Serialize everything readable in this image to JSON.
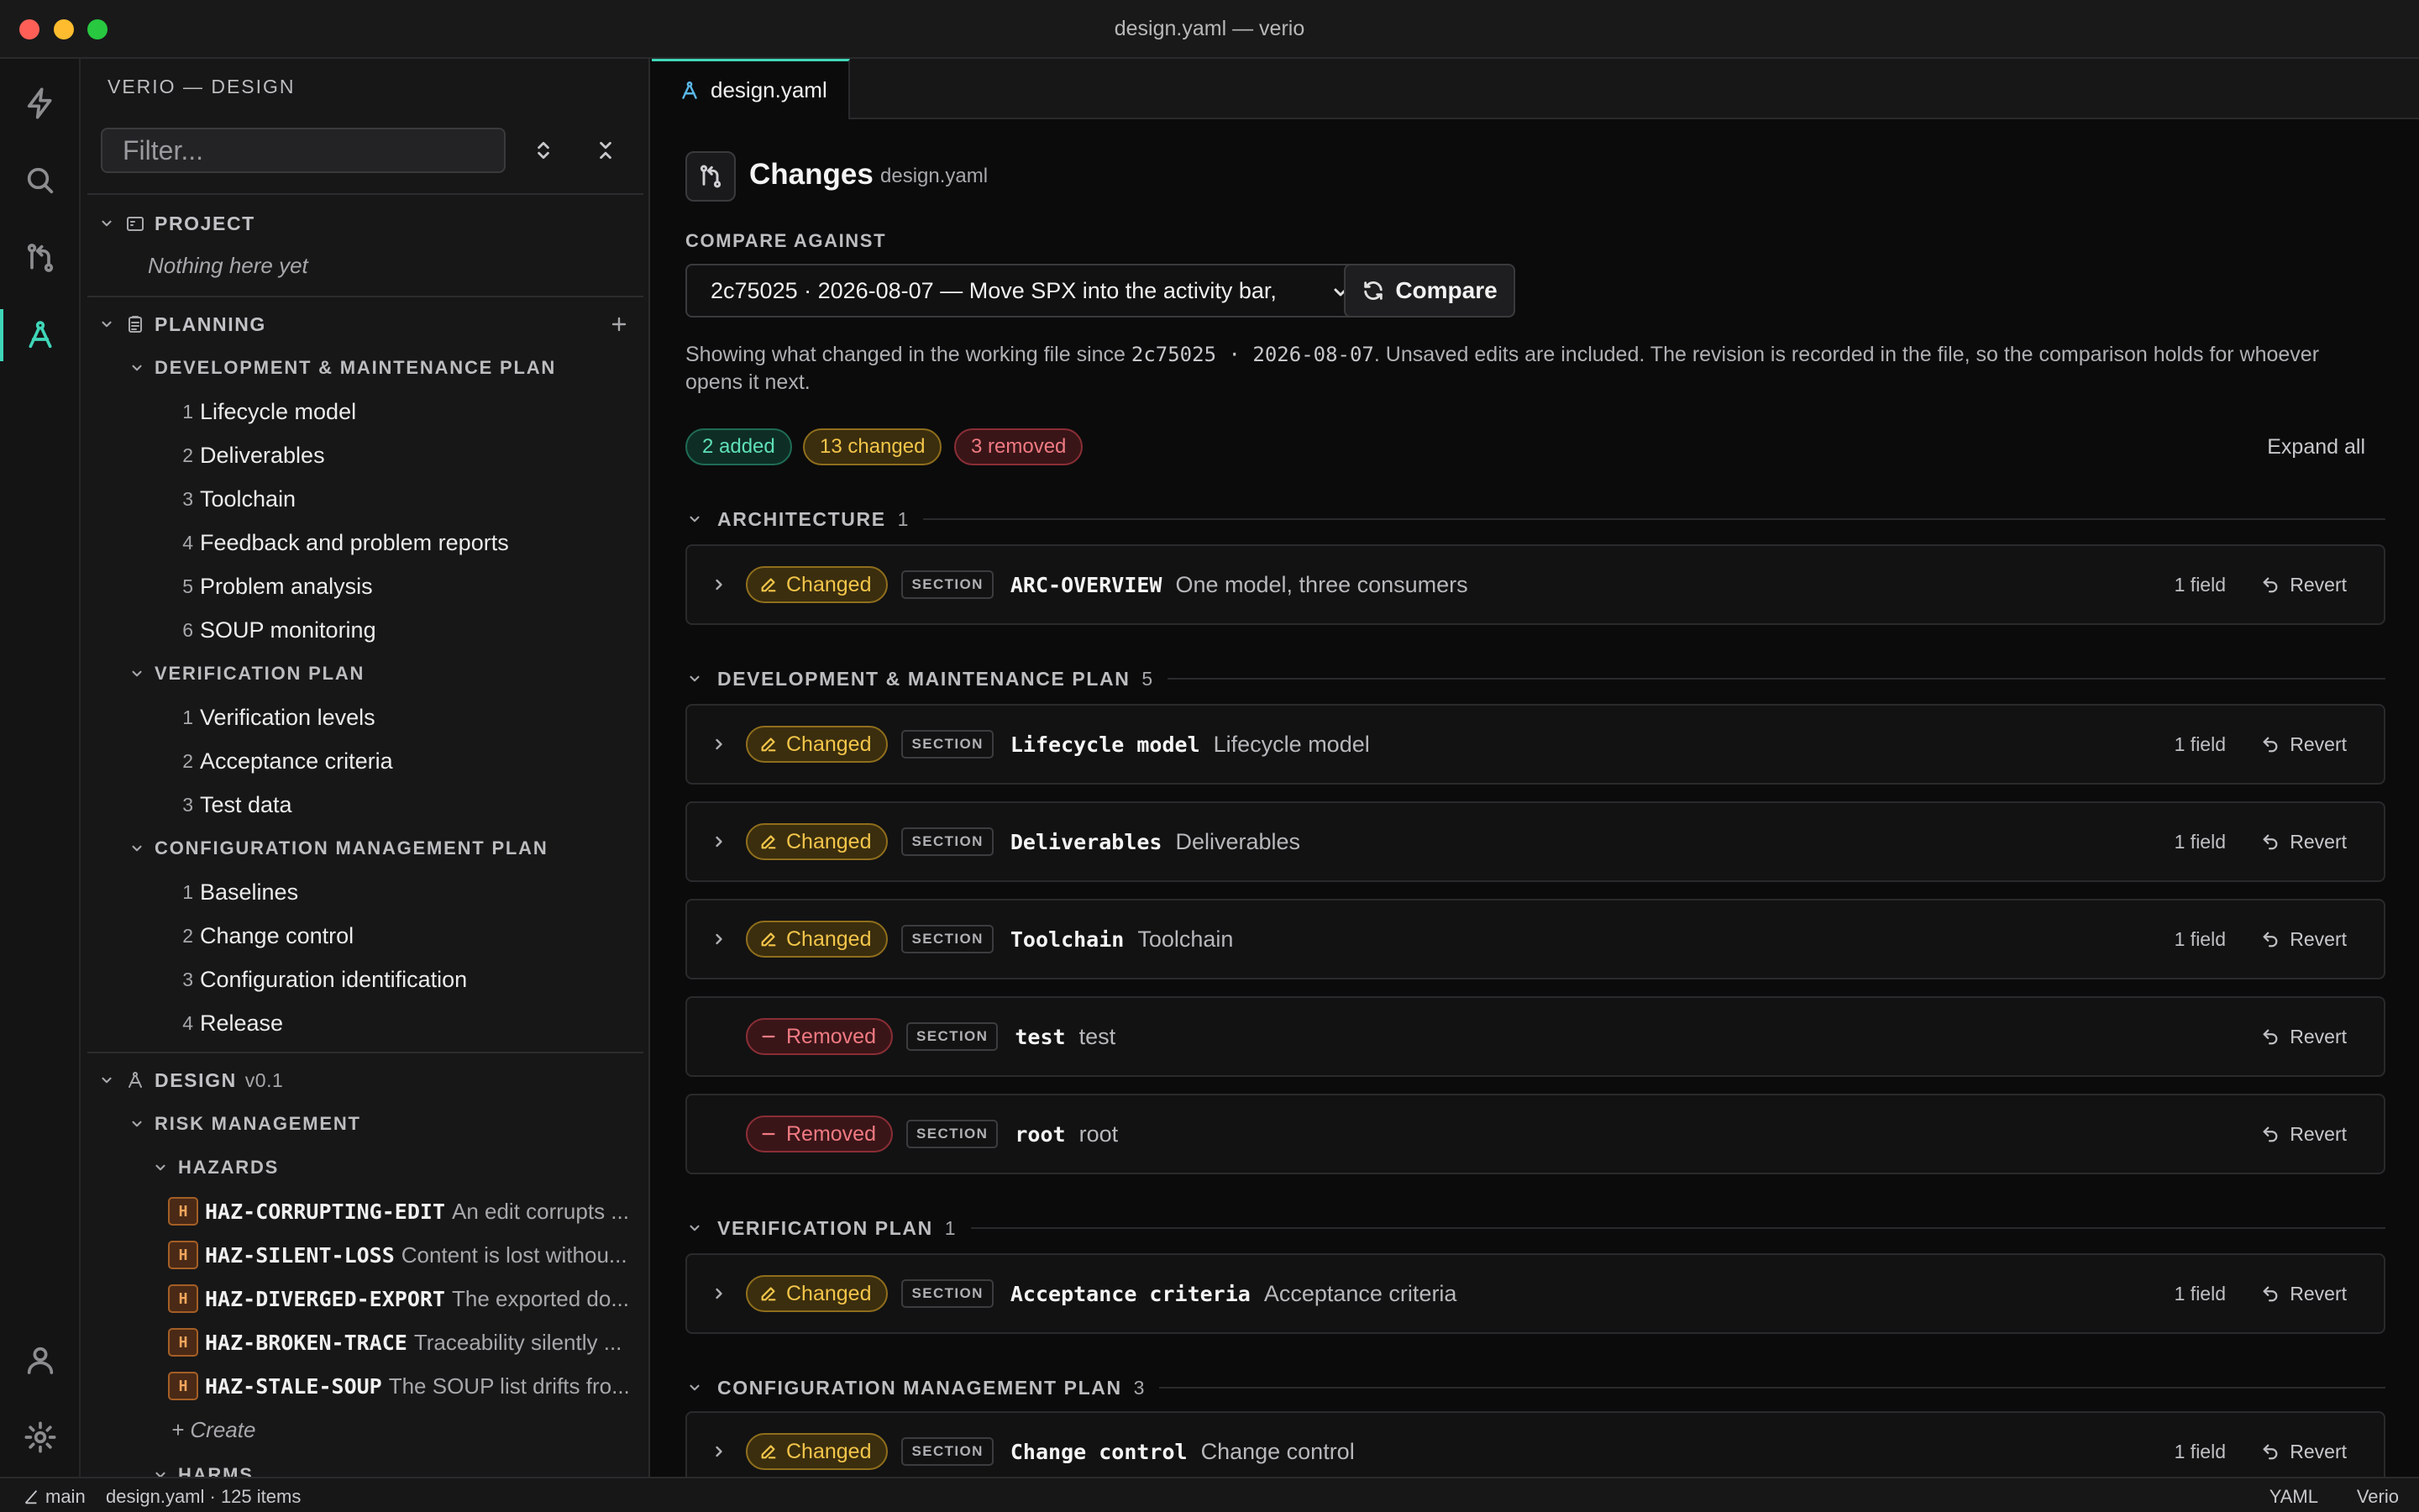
{
  "window": {
    "title": "design.yaml — verio"
  },
  "sidebar": {
    "title": "VERIO — DESIGN",
    "filter_placeholder": "Filter...",
    "project": {
      "label": "PROJECT",
      "empty": "Nothing here yet"
    },
    "planning": {
      "label": "PLANNING",
      "dev_plan": {
        "label": "DEVELOPMENT & MAINTENANCE PLAN",
        "items": [
          {
            "num": "1",
            "label": "Lifecycle model"
          },
          {
            "num": "2",
            "label": "Deliverables"
          },
          {
            "num": "3",
            "label": "Toolchain"
          },
          {
            "num": "4",
            "label": "Feedback and problem reports"
          },
          {
            "num": "5",
            "label": "Problem analysis"
          },
          {
            "num": "6",
            "label": "SOUP monitoring"
          }
        ]
      },
      "ver_plan": {
        "label": "VERIFICATION PLAN",
        "items": [
          {
            "num": "1",
            "label": "Verification levels"
          },
          {
            "num": "2",
            "label": "Acceptance criteria"
          },
          {
            "num": "3",
            "label": "Test data"
          }
        ]
      },
      "cfg_plan": {
        "label": "CONFIGURATION MANAGEMENT PLAN",
        "items": [
          {
            "num": "1",
            "label": "Baselines"
          },
          {
            "num": "2",
            "label": "Change control"
          },
          {
            "num": "3",
            "label": "Configuration identification"
          },
          {
            "num": "4",
            "label": "Release"
          }
        ]
      }
    },
    "design": {
      "label": "DESIGN",
      "version": "v0.1",
      "risk": {
        "label": "RISK MANAGEMENT",
        "hazards": {
          "label": "HAZARDS",
          "badge": "H",
          "items": [
            {
              "id": "HAZ-CORRUPTING-EDIT",
              "desc": "An edit corrupts ..."
            },
            {
              "id": "HAZ-SILENT-LOSS",
              "desc": "Content is lost withou..."
            },
            {
              "id": "HAZ-DIVERGED-EXPORT",
              "desc": "The exported do..."
            },
            {
              "id": "HAZ-BROKEN-TRACE",
              "desc": "Traceability silently ..."
            },
            {
              "id": "HAZ-STALE-SOUP",
              "desc": "The SOUP list drifts fro..."
            }
          ],
          "create": "+ Create"
        },
        "harms_label": "HARMS"
      }
    }
  },
  "tab": {
    "label": "design.yaml"
  },
  "changes": {
    "title": "Changes",
    "file": "design.yaml",
    "compare_label": "COMPARE AGAINST",
    "revision": "2c75025 · 2026-08-07 — Move SPX into the activity bar,",
    "compare_button": "Compare",
    "explain": {
      "p1": "Showing what changed in the working file since ",
      "hash": "2c75025",
      "sep": " · ",
      "date": "2026-08-07",
      "p2": ". Unsaved edits are included. The revision is recorded in the file, so the comparison holds for whoever opens it next."
    },
    "summary": {
      "added": "2 added",
      "changed": "13 changed",
      "removed": "3 removed"
    },
    "expand_all": "Expand all",
    "kind_label": "SECTION",
    "field_label": "1 field",
    "revert_label": "Revert",
    "status_changed": "Changed",
    "status_removed": "Removed",
    "sections": [
      {
        "name": "ARCHITECTURE",
        "count": "1"
      },
      {
        "name": "DEVELOPMENT & MAINTENANCE PLAN",
        "count": "5"
      },
      {
        "name": "VERIFICATION PLAN",
        "count": "1"
      },
      {
        "name": "CONFIGURATION MANAGEMENT PLAN",
        "count": "3"
      }
    ],
    "rows": [
      {
        "id": "ARC-OVERVIEW",
        "title": "One model, three consumers"
      },
      {
        "id": "Lifecycle model",
        "title": "Lifecycle model"
      },
      {
        "id": "Deliverables",
        "title": "Deliverables"
      },
      {
        "id": "Toolchain",
        "title": "Toolchain"
      },
      {
        "id": "test",
        "title": "test"
      },
      {
        "id": "root",
        "title": "root"
      },
      {
        "id": "Acceptance criteria",
        "title": "Acceptance criteria"
      },
      {
        "id": "Change control",
        "title": "Change control"
      }
    ]
  },
  "statusbar": {
    "branch": "main",
    "file_info": "design.yaml · 125 items",
    "language": "YAML",
    "app": "Verio"
  },
  "colors": {
    "accent": "#3fd6b8",
    "changed": "#f3c54a",
    "removed": "#f07a82",
    "added": "#5fe0b8",
    "hazard": "#f2a55c"
  }
}
